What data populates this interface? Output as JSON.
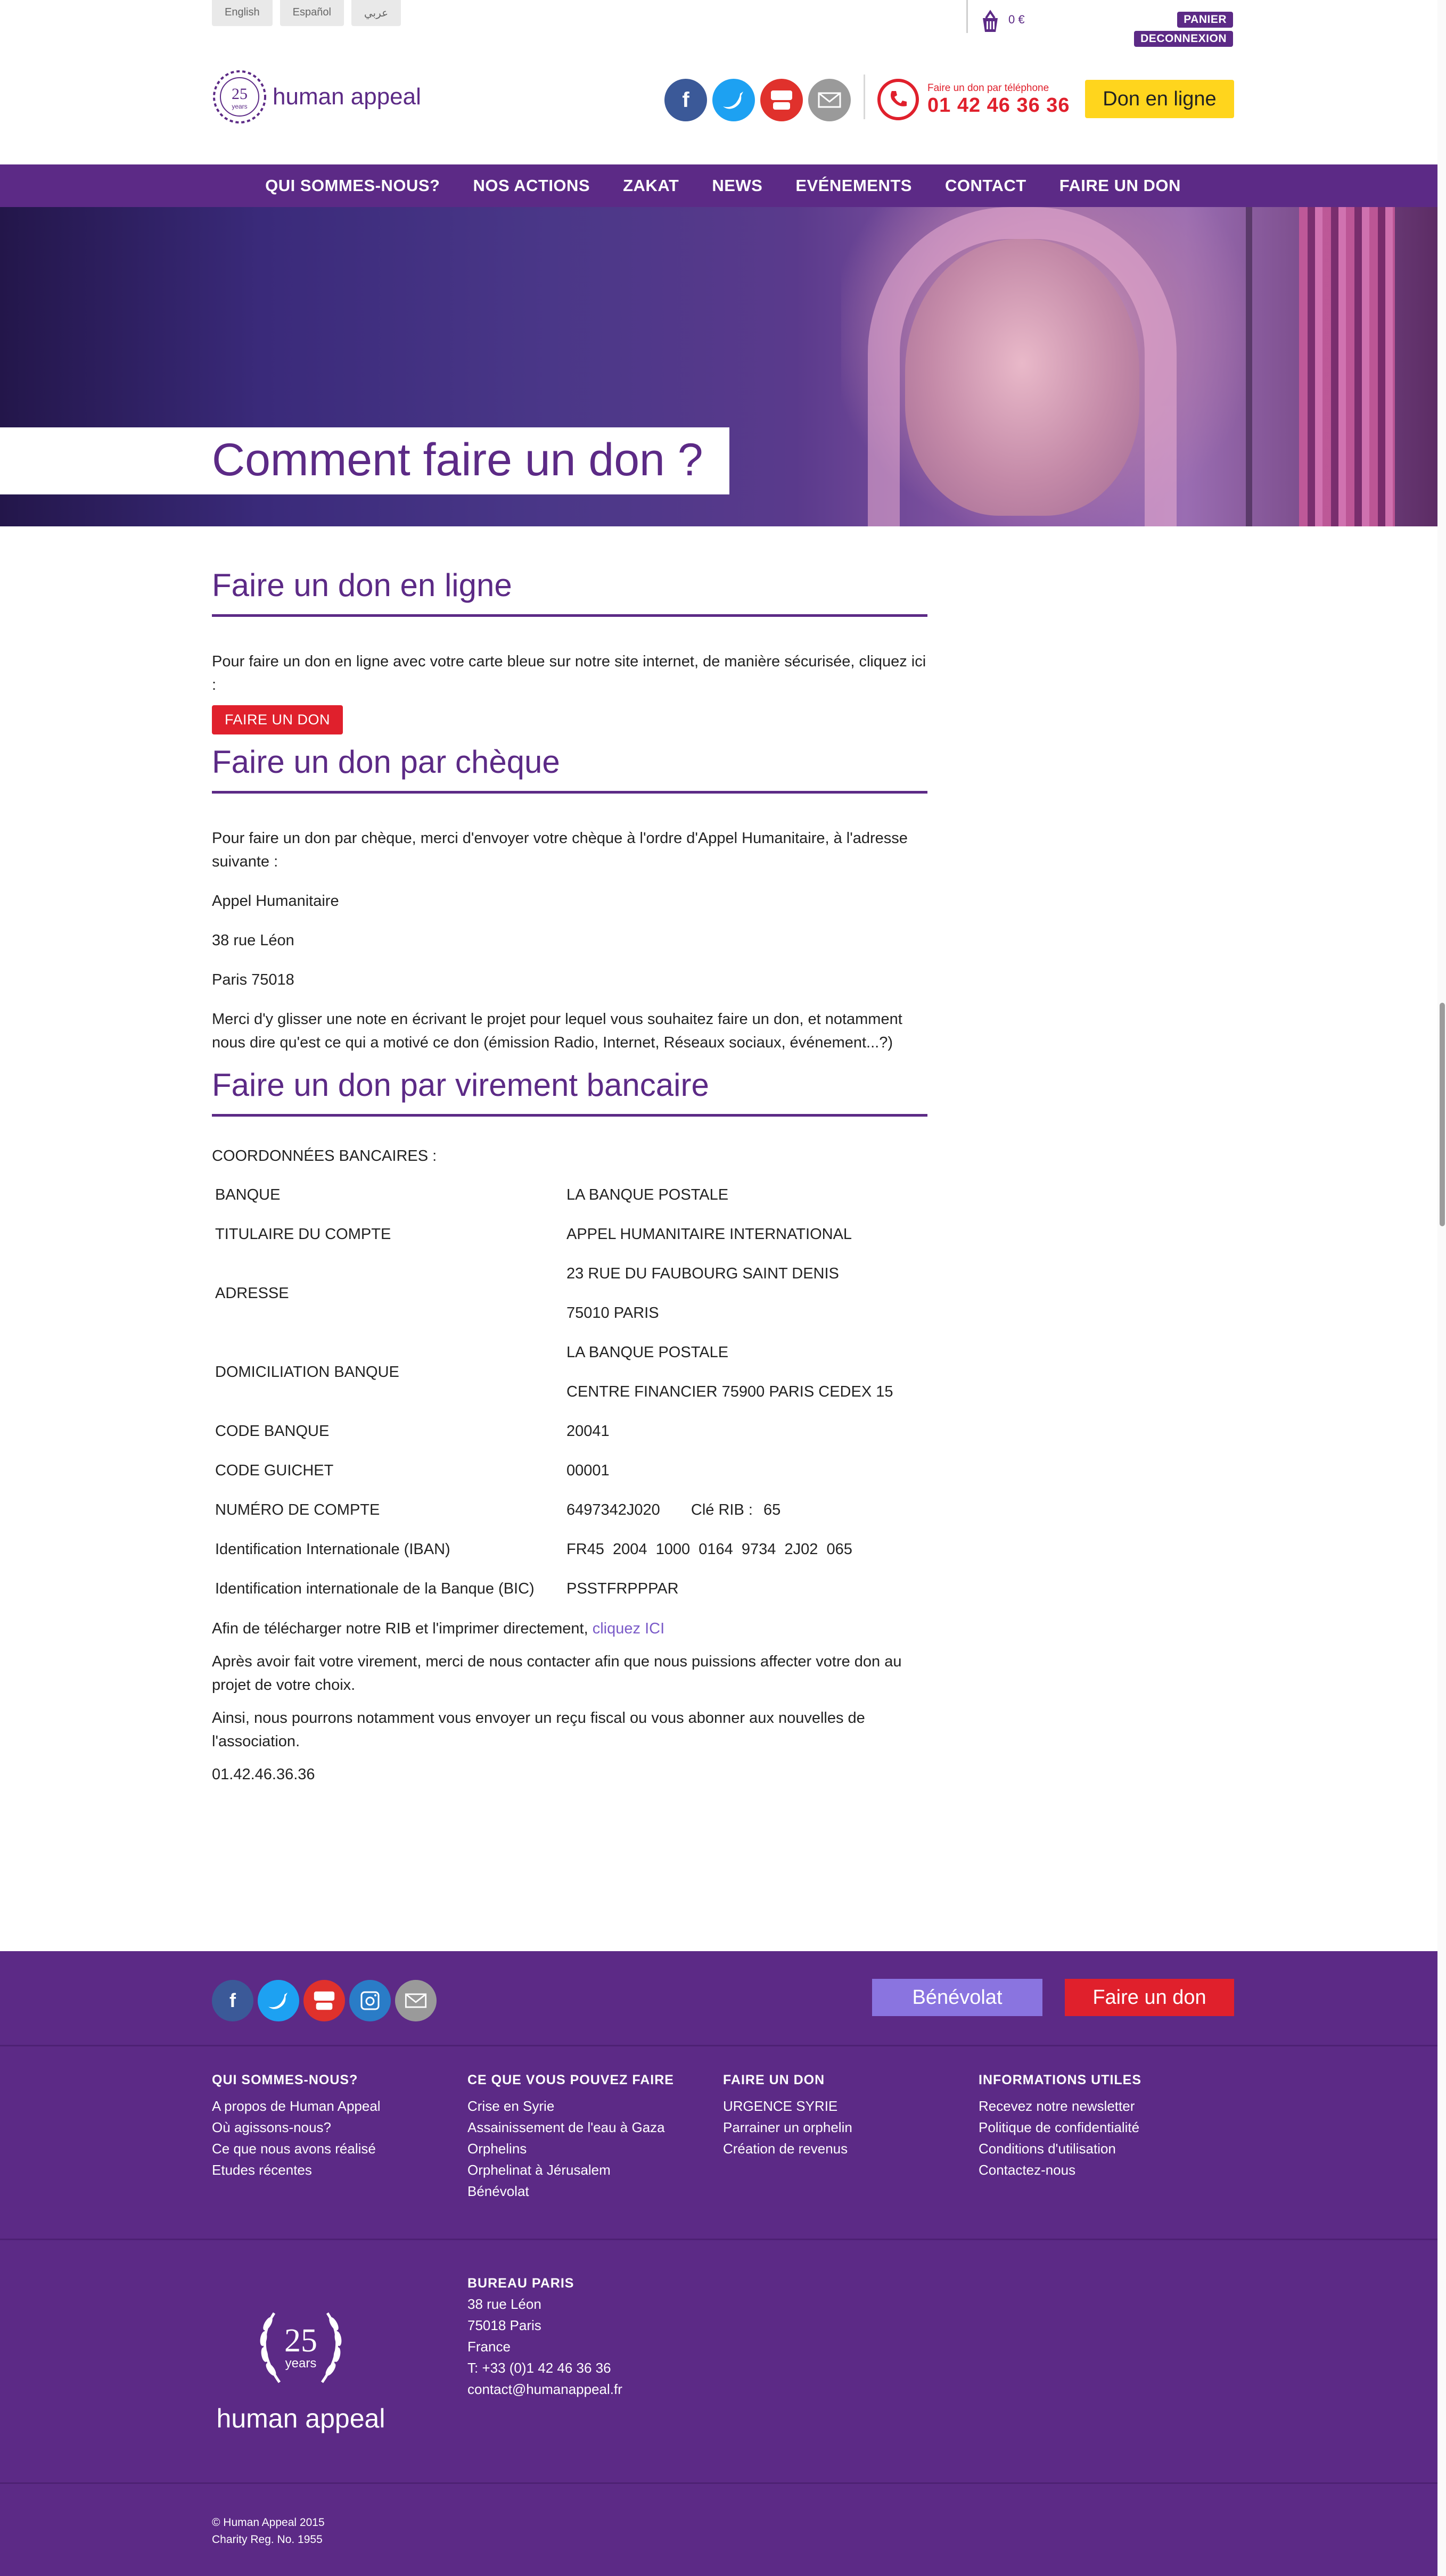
{
  "header": {
    "languages": [
      "English",
      "Español",
      "عربي"
    ],
    "cart_amount": "0 €",
    "panier": "PANIER",
    "deconnexion": "DECONNEXION",
    "logo_text": "human appeal",
    "logo_years_number": "25",
    "logo_years_word": "years",
    "phone_label": "Faire un don par téléphone",
    "phone_number": "01 42 46 36 36",
    "don_en_ligne": "Don en ligne",
    "social_icons": [
      "facebook-icon",
      "twitter-icon",
      "youtube-icon",
      "mail-icon"
    ]
  },
  "nav": {
    "items": [
      "QUI SOMMES-NOUS?",
      "NOS ACTIONS",
      "ZAKAT",
      "NEWS",
      "EVÉNEMENTS",
      "CONTACT",
      "FAIRE UN DON"
    ]
  },
  "hero": {
    "title": "Comment faire un don ?"
  },
  "online": {
    "title": "Faire un don en ligne",
    "text": "Pour faire un don en ligne avec votre carte bleue sur notre site internet, de manière sécurisée, cliquez ici :",
    "button": "FAIRE UN DON"
  },
  "cheque": {
    "title": "Faire un don par chèque",
    "text": "Pour faire un don par chèque, merci d'envoyer votre chèque à l'ordre d'Appel Humanitaire, à l'adresse suivante :",
    "address_name": "Appel Humanitaire",
    "address_street": "38 rue Léon",
    "address_city": "Paris 75018",
    "note": "Merci d'y glisser une note en écrivant le projet pour lequel vous souhaitez faire un don, et notamment nous dire qu'est ce qui a motivé ce don (émission Radio, Internet, Réseaux sociaux, événement...?)"
  },
  "virement": {
    "title": "Faire un don par virement bancaire",
    "coord_label": "COORDONNÉES  BANCAIRES :",
    "rows": {
      "banque": {
        "label": "BANQUE",
        "value": "LA BANQUE POSTALE"
      },
      "titulaire": {
        "label": "TITULAIRE DU COMPTE",
        "value": "APPEL HUMANITAIRE INTERNATIONAL"
      },
      "adresse": {
        "label": "ADRESSE",
        "value1": "23 RUE DU FAUBOURG SAINT DENIS",
        "value2": "75010 PARIS"
      },
      "domiciliation": {
        "label": "DOMICILIATION BANQUE",
        "value1": "LA BANQUE POSTALE",
        "value2": "CENTRE FINANCIER 75900 PARIS CEDEX 15"
      },
      "code_banque": {
        "label": "CODE BANQUE",
        "value": "20041"
      },
      "code_guichet": {
        "label": "CODE GUICHET",
        "value": "00001"
      },
      "numero_compte": {
        "label": "NUMÉRO DE COMPTE",
        "value": "6497342J020",
        "rib_label": "Clé RIB :",
        "rib_value": "65"
      },
      "iban": {
        "label": "Identification Internationale (IBAN)",
        "value": "FR45  2004  1000  0164  9734  2J02  065"
      },
      "bic": {
        "label": "Identification internationale de la Banque (BIC)",
        "value": "PSSTFRPPPAR"
      }
    },
    "rib_text": "Afin de télécharger notre RIB et l'imprimer directement,",
    "rib_link": "cliquez ICI",
    "after1": "Après avoir fait votre virement, merci de nous contacter afin que nous puissions affecter votre don au projet de votre choix.",
    "after2": "Ainsi, nous pourrons notamment vous envoyer un reçu fiscal ou vous abonner aux nouvelles de l'association.",
    "phone": "01.42.46.36.36"
  },
  "footer": {
    "benevolat": "Bénévolat",
    "faire_un_don": "Faire un don",
    "social_icons": [
      "facebook-icon",
      "twitter-icon",
      "youtube-icon",
      "instagram-icon",
      "mail-icon"
    ],
    "columns": [
      {
        "title": "QUI SOMMES-NOUS?",
        "links": [
          "A propos de Human Appeal",
          "Où agissons-nous?",
          "Ce que nous avons réalisé",
          "Etudes récentes"
        ]
      },
      {
        "title": "CE QUE VOUS POUVEZ FAIRE",
        "links": [
          "Crise en Syrie",
          "Assainissement de l'eau à Gaza",
          "Orphelins",
          "Orphelinat à Jérusalem",
          "Bénévolat"
        ]
      },
      {
        "title": "FAIRE UN DON",
        "links": [
          "URGENCE SYRIE",
          "Parrainer un orphelin",
          "Création de revenus"
        ]
      },
      {
        "title": "INFORMATIONS UTILES",
        "links": [
          "Recevez notre newsletter",
          "Politique de confidentialité",
          "Conditions d'utilisation",
          "Contactez-nous"
        ]
      }
    ],
    "logo_years_number": "25",
    "logo_years_word": "years",
    "logo_text": "human appeal",
    "bureau_title": "BUREAU PARIS",
    "bureau_lines": [
      "38 rue Léon",
      "75018 Paris",
      "France",
      "T: +33 (0)1 42 46 36 36",
      "contact@humanappeal.fr"
    ],
    "copyright": "© Human Appeal 2015",
    "charity": "Charity Reg. No. 1955"
  },
  "colors": {
    "brand_purple": "#5c2a86",
    "accent_red": "#e0202c",
    "accent_yellow": "#ffd51d",
    "benevolat_purple": "#8a74e0"
  }
}
